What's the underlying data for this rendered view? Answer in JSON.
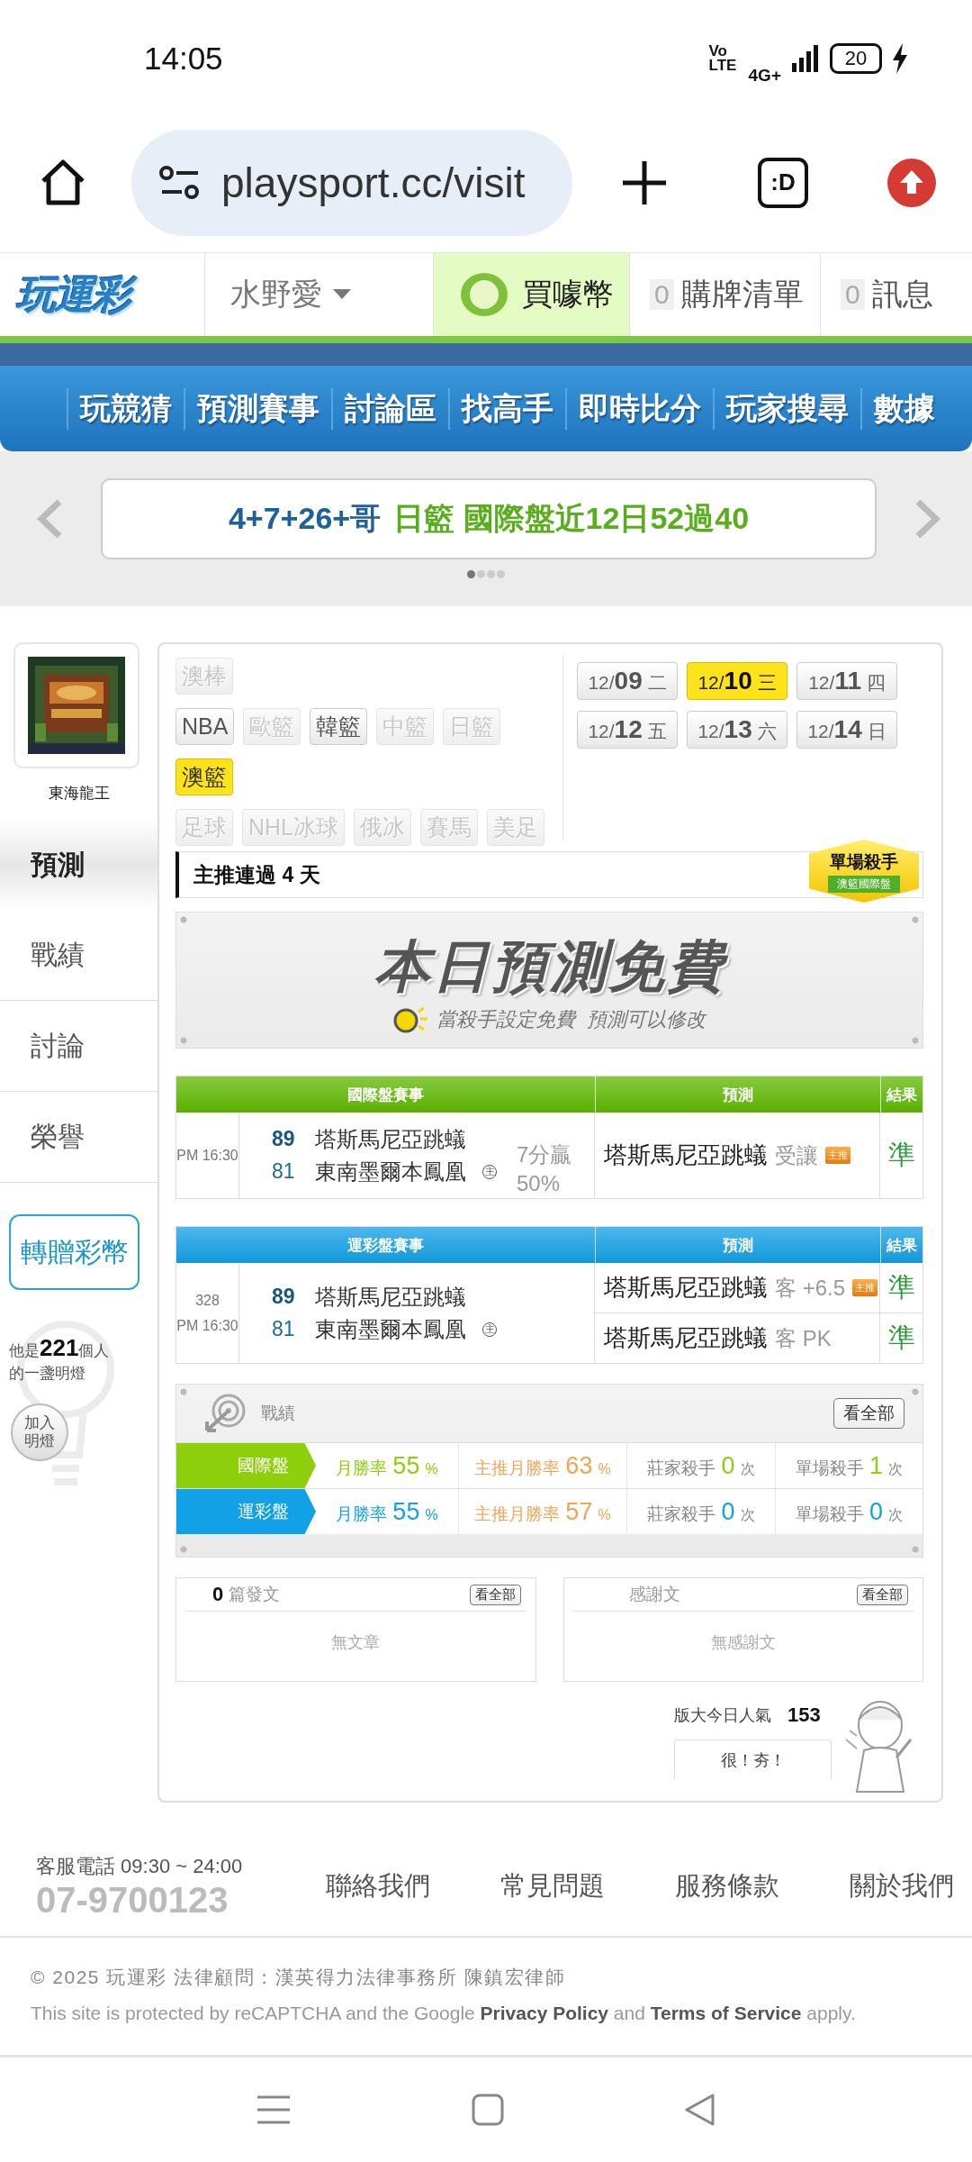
{
  "status_bar": {
    "time": "14:05",
    "volte": "Vo LTE",
    "network": "4G+",
    "battery": "20"
  },
  "browser": {
    "url": "playsport.cc/visit",
    "tabs_label": ":D"
  },
  "header": {
    "logo": "玩運彩",
    "user": "水野愛",
    "coins": "買噱幣",
    "cart": {
      "count": "0",
      "label": "購牌清單"
    },
    "messages": {
      "count": "0",
      "label": "訊息"
    }
  },
  "nav": [
    "玩競猜",
    "預測賽事",
    "討論區",
    "找高手",
    "即時比分",
    "玩家搜尋",
    "數據"
  ],
  "banner": {
    "parts": [
      {
        "text": "4+7+26+哥",
        "kind": "name"
      },
      {
        "text": "日籃 國際盤近12日52過40",
        "kind": "highlight"
      }
    ],
    "pages": [
      {
        "selected": true
      },
      {
        "selected": false
      },
      {
        "selected": false
      },
      {
        "selected": false
      }
    ]
  },
  "profile": {
    "name": "東海龍王",
    "tabs": [
      {
        "label": "預測",
        "selected": true
      },
      {
        "label": "戰績",
        "selected": false
      },
      {
        "label": "討論",
        "selected": false
      },
      {
        "label": "榮譽",
        "selected": false
      }
    ],
    "gift_button": "轉贈彩幣",
    "lamp_text": "他是**221**個人的一盞明燈",
    "lamp_button": "加入明燈"
  },
  "filters": {
    "sport_rows": [
      [
        {
          "label": "澳棒",
          "disabled": true,
          "selected": false
        }
      ],
      [
        {
          "label": "NBA",
          "disabled": false,
          "selected": false
        },
        {
          "label": "歐籃",
          "disabled": true,
          "selected": false
        },
        {
          "label": "韓籃",
          "disabled": false,
          "selected": false
        },
        {
          "label": "中籃",
          "disabled": true,
          "selected": false
        },
        {
          "label": "日籃",
          "disabled": true,
          "selected": false
        }
      ],
      [
        {
          "label": "澳籃",
          "disabled": false,
          "selected": true
        }
      ],
      [
        {
          "label": "足球",
          "disabled": true,
          "selected": false
        },
        {
          "label": "NHL冰球",
          "disabled": true,
          "selected": false
        },
        {
          "label": "俄冰",
          "disabled": true,
          "selected": false
        },
        {
          "label": "賽馬",
          "disabled": true,
          "selected": false
        },
        {
          "label": "美足",
          "disabled": true,
          "selected": false
        }
      ]
    ],
    "dates": [
      {
        "month": "12/",
        "day": "09",
        "weekday": "二",
        "selected": false
      },
      {
        "month": "12/",
        "day": "10",
        "weekday": "三",
        "selected": true
      },
      {
        "month": "12/",
        "day": "11",
        "weekday": "四",
        "selected": false
      },
      {
        "month": "12/",
        "day": "12",
        "weekday": "五",
        "selected": false
      },
      {
        "month": "12/",
        "day": "13",
        "weekday": "六",
        "selected": false
      },
      {
        "month": "12/",
        "day": "14",
        "weekday": "日",
        "selected": false
      }
    ]
  },
  "streak": {
    "text": "主推連過 4 天",
    "badge_title": "單場殺手",
    "badge_subtitle": "澳籃國際盤"
  },
  "free_banner": {
    "title": "本日預測免費",
    "subtitle": "當殺手設定免費  預測可以修改"
  },
  "tables": [
    {
      "color": "#5fb800",
      "columns": [
        "國際盤賽事",
        "預測",
        "結果"
      ],
      "games": [
        {
          "time": "PM 16:30",
          "teams": [
            {
              "score": "89",
              "name": "塔斯馬尼亞跳蟻",
              "winner": true
            },
            {
              "score": "81",
              "name": "東南墨爾本鳳凰",
              "winner": false,
              "home_mark": "主"
            }
          ],
          "note": [
            "7分贏",
            "50%"
          ],
          "predictions": [
            {
              "team": "塔斯馬尼亞跳蟻",
              "pick": "受讓",
              "tag": "主推",
              "result": "準"
            }
          ]
        }
      ]
    },
    {
      "color": "#12a0e6",
      "columns": [
        "運彩盤賽事",
        "預測",
        "結果"
      ],
      "games": [
        {
          "number": "328",
          "time": "PM 16:30",
          "teams": [
            {
              "score": "89",
              "name": "塔斯馬尼亞跳蟻",
              "winner": true
            },
            {
              "score": "81",
              "name": "東南墨爾本鳳凰",
              "winner": false,
              "home_mark": "主"
            }
          ],
          "predictions": [
            {
              "team": "塔斯馬尼亞跳蟻",
              "pick": "客 +6.5",
              "tag": "主推",
              "result": "準"
            },
            {
              "team": "塔斯馬尼亞跳蟻",
              "pick": "客 PK",
              "result": "準"
            }
          ]
        }
      ]
    }
  ],
  "stats": {
    "title": "戰績",
    "view_all": "看全部",
    "rows": [
      {
        "label": "國際盤",
        "color": "#8ccf0a",
        "cells": [
          {
            "kind": "rate",
            "label": "月勝率",
            "value": "55",
            "unit": "%",
            "color": "#8ccf0a"
          },
          {
            "kind": "rate",
            "label": "主推月勝率",
            "value": "63",
            "unit": "%",
            "color": "#f0a555"
          },
          {
            "kind": "count",
            "label": "莊家殺手",
            "value": "0",
            "unit": "次",
            "color": "#8ccf0a"
          },
          {
            "kind": "count",
            "label": "單場殺手",
            "value": "1",
            "unit": "次",
            "color": "#8ccf0a"
          }
        ]
      },
      {
        "label": "運彩盤",
        "color": "#12a0e6",
        "cells": [
          {
            "kind": "rate",
            "label": "月勝率",
            "value": "55",
            "unit": "%",
            "color": "#12a0e6"
          },
          {
            "kind": "rate",
            "label": "主推月勝率",
            "value": "57",
            "unit": "%",
            "color": "#f0a555"
          },
          {
            "kind": "count",
            "label": "莊家殺手",
            "value": "0",
            "unit": "次",
            "color": "#12a0e6"
          },
          {
            "kind": "count",
            "label": "單場殺手",
            "value": "0",
            "unit": "次",
            "color": "#12a0e6"
          }
        ]
      }
    ]
  },
  "posts": {
    "count": "0",
    "title": "篇發文",
    "view_all": "看全部",
    "empty": "無文章"
  },
  "thanks": {
    "title": "感謝文",
    "view_all": "看全部",
    "empty": "無感謝文"
  },
  "popularity": {
    "label": "版大今日人氣",
    "value": "153",
    "button": "很！夯！"
  },
  "footer": {
    "hours": "客服電話 09:30 ~ 24:00",
    "phone": "07-9700123",
    "links": [
      "聯絡我們",
      "常見問題",
      "服務條款",
      "關於我們"
    ],
    "copyright": "© 2025 玩運彩 法律顧問：漢英得力法律事務所 陳鎮宏律師",
    "recaptcha": [
      {
        "text": "This site is protected by reCAPTCHA and the Google "
      },
      {
        "text": "Privacy Policy",
        "kind": "link"
      },
      {
        "text": " and "
      },
      {
        "text": "Terms of Service",
        "kind": "link"
      },
      {
        "text": " apply."
      }
    ]
  }
}
